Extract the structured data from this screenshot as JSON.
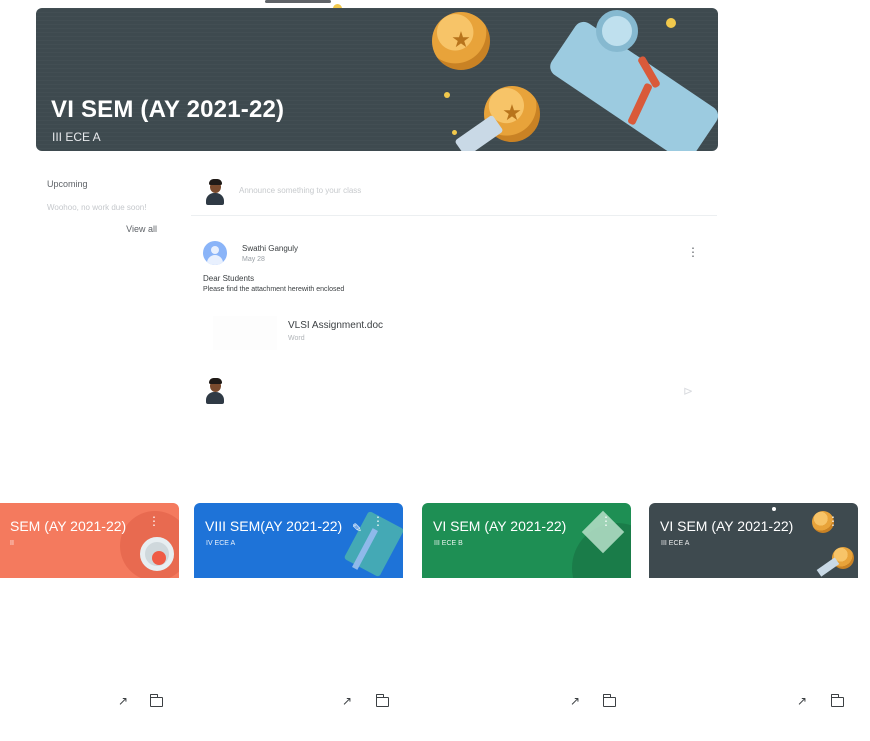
{
  "colors": {
    "banner_bg": "#3e4a4f",
    "card_orange": "#f47a5e",
    "card_blue": "#1e73d8",
    "card_green": "#1e8f54",
    "card_dark": "#3e4a4f"
  },
  "banner": {
    "title": "VI SEM (AY 2021-22)",
    "section": "III ECE A"
  },
  "upcoming": {
    "title": "Upcoming",
    "empty_text": "Woohoo, no work due soon!",
    "view_all": "View all"
  },
  "announce": {
    "placeholder": "Announce something to your class"
  },
  "post": {
    "author": "Swathi Ganguly",
    "date": "May 28",
    "body_line1": "Dear Students",
    "body_line2": "Please find the attachment herewith enclosed",
    "attachment_name": "VLSI Assignment.doc",
    "attachment_type": "Word",
    "menu_icon": "more-vert-icon",
    "send_icon": "send-icon"
  },
  "cards": [
    {
      "title": "SEM (AY 2021-22)",
      "sub": "II"
    },
    {
      "title": "VIII SEM(AY 2021-22)",
      "sub": "IV ECE A"
    },
    {
      "title": "VI SEM (AY 2021-22)",
      "sub": "III ECE B"
    },
    {
      "title": "VI SEM (AY 2021-22)",
      "sub": "III ECE A"
    }
  ]
}
